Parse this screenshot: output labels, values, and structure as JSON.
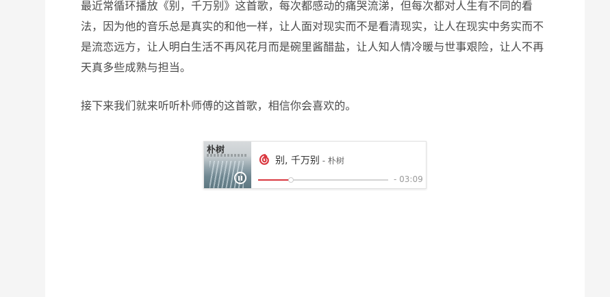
{
  "article": {
    "paragraph1": "最近常循环播放《别，千万别》这首歌，每次都感动的痛哭流涕，但每次都对人生有不同的看法，因为他的音乐总是真实的和他一样，让人面对现实而不是看清现实，让人在现实中务实而不是流恋远方，让人明白生活不再风花月而是碗里酱醋盐，让人知人情冷暖与世事艰险，让人不再天真多些成熟与担当。",
    "paragraph2": "接下来我们就来听听朴师傅的这首歌，相信你会喜欢的。"
  },
  "player": {
    "cover_title": "朴树",
    "song_title": "别, 千万别",
    "separator": " - ",
    "artist": "朴树",
    "time": "- 03:09",
    "progress": 0.25,
    "accent_color": "#d9363e",
    "play_state_icon": "pause-icon",
    "brand_icon": "netease-cloud-music-icon"
  }
}
